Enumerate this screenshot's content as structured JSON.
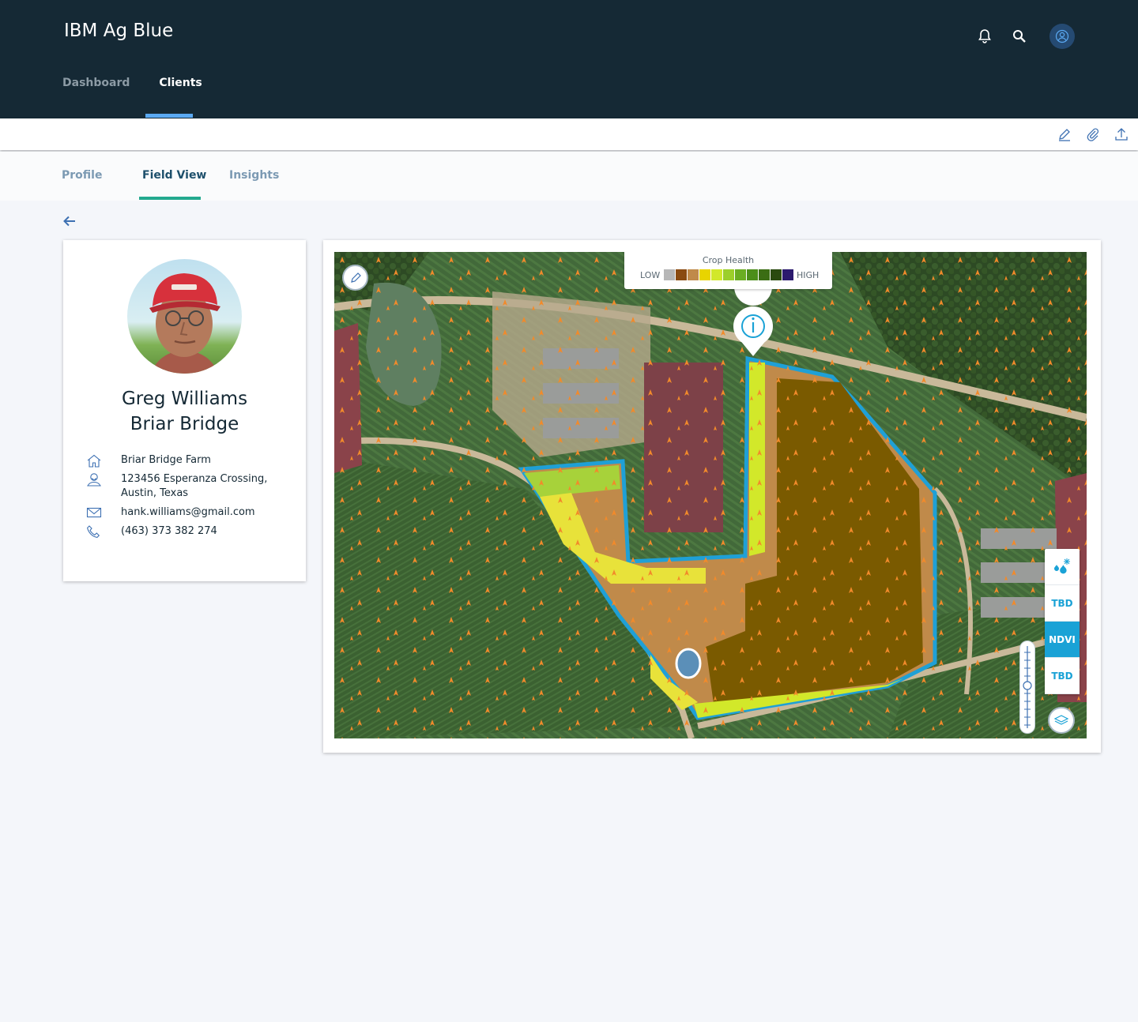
{
  "app": {
    "title": "IBM Ag Blue"
  },
  "nav": {
    "items": [
      {
        "label": "Dashboard"
      },
      {
        "label": "Clients"
      }
    ],
    "active": "Clients"
  },
  "subtabs": {
    "items": [
      {
        "label": "Profile"
      },
      {
        "label": "Field View"
      },
      {
        "label": "Insights"
      }
    ],
    "active": "Field View"
  },
  "profile": {
    "name": "Greg Williams",
    "farm_title": "Briar Bridge",
    "farm_name": "Briar Bridge Farm",
    "address_line1": "123456 Esperanza Crossing,",
    "address_line2": "Austin, Texas",
    "email": "hank.williams@gmail.com",
    "phone": "(463) 373 382 274"
  },
  "legend": {
    "title": "Crop Health",
    "low_label": "LOW",
    "high_label": "HIGH",
    "colors": [
      "#b7b7b7",
      "#8a4a10",
      "#c08a4a",
      "#e8d400",
      "#d2e82a",
      "#9ccf2a",
      "#6aad22",
      "#4c8e1a",
      "#3b6d14",
      "#2a4a10",
      "#2b1a6e"
    ]
  },
  "layers": {
    "items": [
      {
        "label": ""
      },
      {
        "label": "TBD"
      },
      {
        "label": "NDVI"
      },
      {
        "label": "TBD"
      }
    ],
    "active": "NDVI"
  },
  "colors": {
    "header_bg": "#152935",
    "accent": "#1aa2d6",
    "tab_underline": "#23a98f",
    "nav_underline": "#5aa9f2"
  }
}
